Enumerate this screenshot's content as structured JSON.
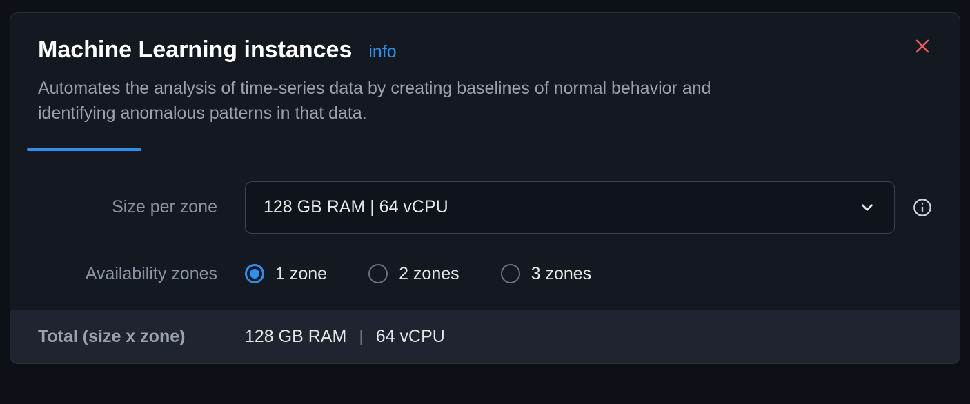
{
  "header": {
    "title": "Machine Learning instances",
    "info_link": "info",
    "description": "Automates the analysis of time-series data by creating baselines of normal behavior and identifying anomalous patterns in that data."
  },
  "form": {
    "size_per_zone": {
      "label": "Size per zone",
      "selected": "128 GB RAM | 64 vCPU"
    },
    "availability_zones": {
      "label": "Availability zones",
      "options": [
        {
          "label": "1 zone",
          "selected": true
        },
        {
          "label": "2 zones",
          "selected": false
        },
        {
          "label": "3 zones",
          "selected": false
        }
      ]
    }
  },
  "total": {
    "label": "Total (size x zone)",
    "ram": "128 GB RAM",
    "cpu": "64 vCPU"
  }
}
